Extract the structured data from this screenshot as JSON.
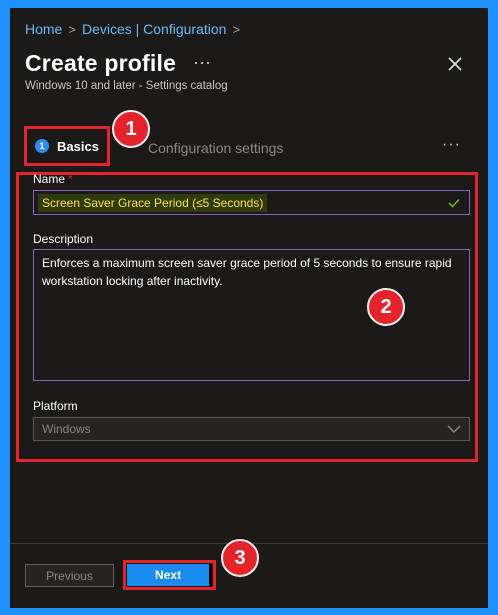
{
  "breadcrumb": {
    "home": "Home",
    "separator": ">",
    "devices": "Devices | Configuration",
    "trail": ">"
  },
  "header": {
    "title": "Create profile",
    "more": "···",
    "subtitle": "Windows 10 and later - Settings catalog"
  },
  "tabs": [
    {
      "step": "1",
      "label": "Basics"
    },
    {
      "label": "Configuration settings"
    }
  ],
  "tabs_more": "···",
  "annotations": {
    "badge1": "1",
    "badge2": "2",
    "badge3": "3"
  },
  "form": {
    "name_label": "Name",
    "required_mark": "*",
    "name_value": "Screen Saver Grace Period (≤5 Seconds)",
    "description_label": "Description",
    "description_value": "Enforces a maximum screen saver grace period of 5 seconds to ensure rapid workstation locking after inactivity.",
    "platform_label": "Platform",
    "platform_value": "Windows"
  },
  "footer": {
    "previous_label": "Previous",
    "next_label": "Next"
  },
  "colors": {
    "accent": "#1a8cf0",
    "highlight_border": "#e3242b",
    "field_border": "#8764b8",
    "background": "#1b1a19"
  }
}
